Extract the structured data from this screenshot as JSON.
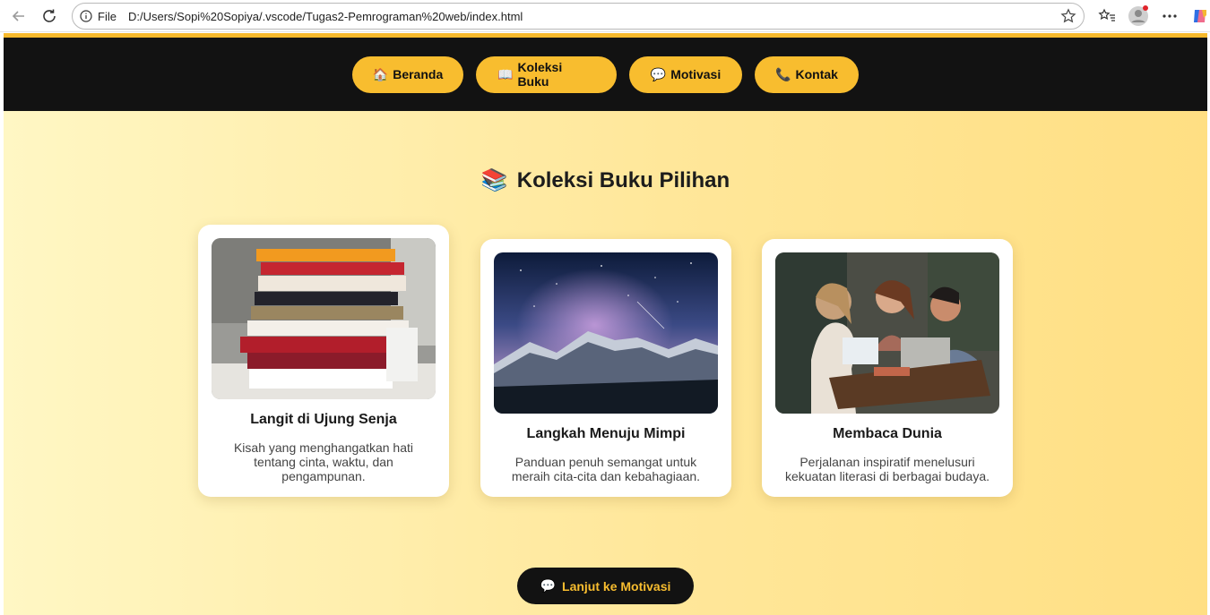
{
  "browser": {
    "file_label": "File",
    "url": "D:/Users/Sopi%20Sopiya/.vscode/Tugas2-Pemrograman%20web/index.html"
  },
  "nav": [
    {
      "icon": "🏠",
      "label": "Beranda"
    },
    {
      "icon": "📖",
      "label": "Koleksi Buku"
    },
    {
      "icon": "💬",
      "label": "Motivasi"
    },
    {
      "icon": "📞",
      "label": "Kontak"
    }
  ],
  "section": {
    "icon": "📚",
    "title": "Koleksi Buku Pilihan"
  },
  "cards": [
    {
      "title": "Langit di Ujung Senja",
      "description": "Kisah yang menghangatkan hati tentang cinta, waktu, dan pengampunan."
    },
    {
      "title": "Langkah Menuju Mimpi",
      "description": "Panduan penuh semangat untuk meraih cita-cita dan kebahagiaan."
    },
    {
      "title": "Membaca Dunia",
      "description": "Perjalanan inspiratif menelusuri kekuatan literasi di berbagai budaya."
    }
  ],
  "cta": {
    "icon": "💬",
    "label": "Lanjut ke Motivasi"
  },
  "colors": {
    "accent": "#f8bd2f",
    "navbar": "#121212",
    "background_start": "#fff7c4",
    "background_end": "#ffdf83"
  }
}
